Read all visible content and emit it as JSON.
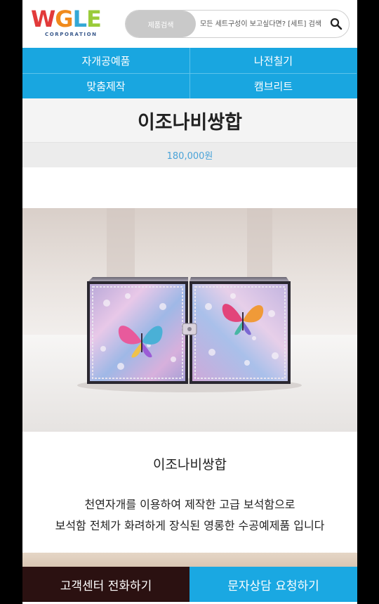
{
  "header": {
    "logo_word": "WGLE",
    "logo_sub": "CORPORATION",
    "search_category": "제품검색",
    "search_placeholder": "모든 세트구성이 보고싶다면? [세트] 검색"
  },
  "nav": {
    "items": [
      {
        "label": "자개공예품"
      },
      {
        "label": "나전칠기"
      },
      {
        "label": "맞춤제작"
      },
      {
        "label": "캠브리트"
      }
    ]
  },
  "product": {
    "title": "이조나비쌍합",
    "price": "180,000원",
    "caption": "이조나비쌍합",
    "description": [
      "천연자개를 이용하여 제작한 고급 보석함으로",
      "보석함 전체가 화려하게 장식된 영롱한 수공예제품 입니다"
    ]
  },
  "actions": {
    "call_label": "고객센터 전화하기",
    "sms_label": "문자상담 요청하기"
  },
  "colors": {
    "accent": "#19a6e0",
    "call_bg": "#2b1111",
    "price": "#4aa3d8"
  }
}
